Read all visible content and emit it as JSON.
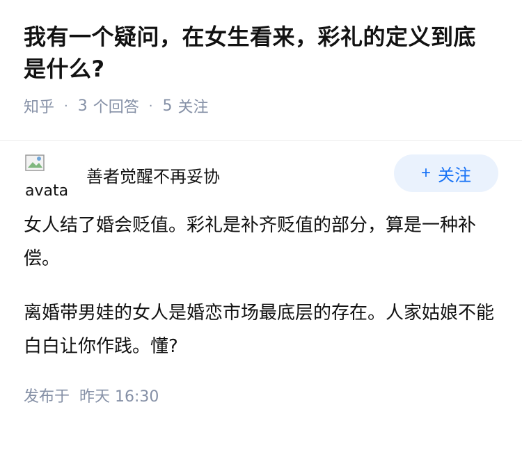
{
  "question": {
    "title": "我有一个疑问，在女生看来，彩礼的定义到底是什么?",
    "source": "知乎",
    "answer_count": "3",
    "answer_label": "个回答",
    "follow_count": "5",
    "follow_label": "关注"
  },
  "answer": {
    "avatar_alt": "avatar",
    "author": "善者觉醒不再妥协",
    "follow_button": "关注",
    "paragraphs": [
      "女人结了婚会贬值。彩礼是补齐贬值的部分，算是一种补偿。",
      "离婚带男娃的女人是婚恋市场最底层的存在。人家姑娘不能白白让你作践。懂?"
    ],
    "publish_label": "发布于",
    "publish_time": "昨天 16:30"
  },
  "icons": {
    "avatar": "broken-image-icon",
    "follow": "plus-icon"
  },
  "colors": {
    "accent": "#1772f6",
    "accent_bg": "#eaf2fd",
    "meta": "#8590a6"
  }
}
